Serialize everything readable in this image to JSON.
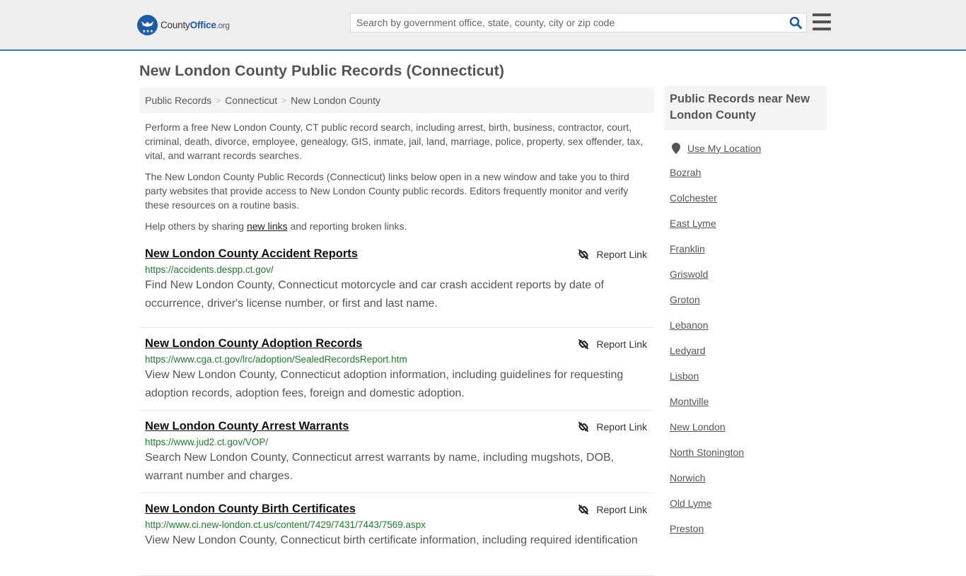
{
  "header": {
    "logo": {
      "name_part1": "County",
      "name_part2": "Office",
      "name_part3": ".org"
    },
    "search": {
      "placeholder": "Search by government office, state, county, city or zip code",
      "value": ""
    },
    "search_icon": "search-icon",
    "menu_icon": "hamburger-menu-icon"
  },
  "page": {
    "title": "New London County Public Records (Connecticut)"
  },
  "breadcrumb": [
    {
      "label": "Public Records"
    },
    {
      "label": "Connecticut"
    },
    {
      "label": "New London County"
    }
  ],
  "breadcrumb_separator": ">",
  "intro": {
    "p1": "Perform a free New London County, CT public record search, including arrest, birth, business, contractor, court, criminal, death, divorce, employee, genealogy, GIS, inmate, jail, land, marriage, police, property, sex offender, tax, vital, and warrant records searches.",
    "p2": "The New London County Public Records (Connecticut) links below open in a new window and take you to third party websites that provide access to New London County public records. Editors frequently monitor and verify these resources on a routine basis.",
    "p3_before": "Help others by sharing ",
    "p3_link": "new links",
    "p3_after": " and reporting broken links."
  },
  "records": [
    {
      "title": "New London County Accident Reports",
      "url": "https://accidents.despp.ct.gov/",
      "description": "Find New London County, Connecticut motorcycle and car crash accident reports by date of occurrence, driver's license number, or first and last name.",
      "report_label": "Report Link"
    },
    {
      "title": "New London County Adoption Records",
      "url": "https://www.cga.ct.gov/lrc/adoption/SealedRecordsReport.htm",
      "description": "View New London County, Connecticut adoption information, including guidelines for requesting adoption records, adoption fees, foreign and domestic adoption.",
      "report_label": "Report Link"
    },
    {
      "title": "New London County Arrest Warrants",
      "url": "https://www.jud2.ct.gov/VOP/",
      "description": "Search New London County, Connecticut arrest warrants by name, including mugshots, DOB, warrant number and charges.",
      "report_label": "Report Link"
    },
    {
      "title": "New London County Birth Certificates",
      "url": "http://www.ci.new-london.ct.us/content/7429/7431/7443/7569.aspx",
      "description": "View New London County, Connecticut birth certificate information, including required identification",
      "report_label": "Report Link"
    }
  ],
  "sidebar": {
    "heading": "Public Records near New London County",
    "use_location": "Use My Location",
    "towns": [
      "Bozrah",
      "Colchester",
      "East Lyme",
      "Franklin",
      "Griswold",
      "Groton",
      "Lebanon",
      "Ledyard",
      "Lisbon",
      "Montville",
      "New London",
      "North Stonington",
      "Norwich",
      "Old Lyme",
      "Preston"
    ]
  },
  "colors": {
    "accent": "#337ab7",
    "logo_blue": "#1f5aa6",
    "url_green": "#217a30",
    "text": "#555555",
    "header_bg": "#eeeeee"
  }
}
